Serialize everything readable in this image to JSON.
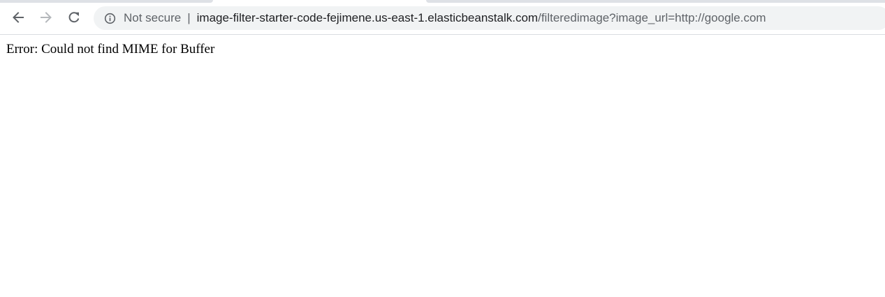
{
  "toolbar": {
    "back_icon": "arrow-left-icon",
    "forward_icon": "arrow-right-icon",
    "reload_icon": "reload-icon"
  },
  "omnibox": {
    "security_icon": "info-icon",
    "security_label": "Not secure",
    "separator": "|",
    "url_host": "image-filter-starter-code-fejimene.us-east-1.elasticbeanstalk.com",
    "url_path": "/filteredimage?image_url=http://google.com"
  },
  "page": {
    "error_message": "Error: Could not find MIME for Buffer"
  },
  "colors": {
    "toolbar_bg": "#ffffff",
    "omnibox_bg": "#f1f3f4",
    "muted_text": "#5f6368",
    "primary_text": "#202124"
  }
}
